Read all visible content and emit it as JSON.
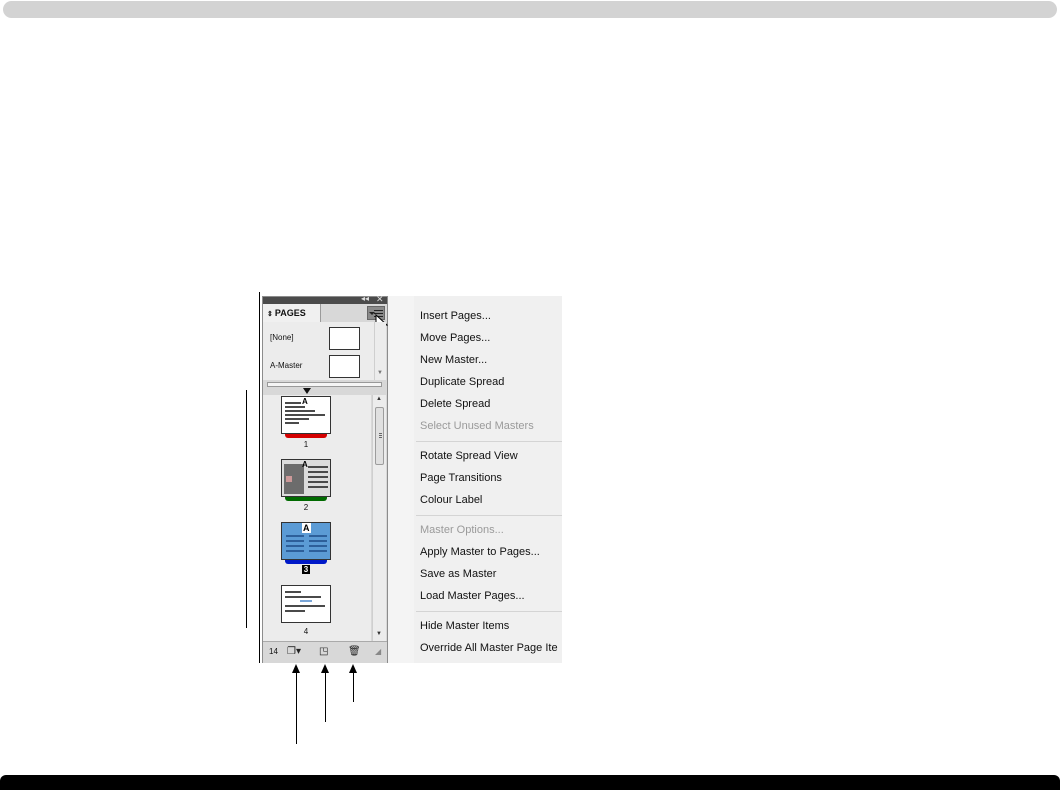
{
  "panel": {
    "tab_label": "PAGES",
    "masters": [
      {
        "label": "[None]"
      },
      {
        "label": "A-Master"
      }
    ],
    "pages": [
      {
        "number": "1",
        "master_letter": "A",
        "label_color": "#d40000"
      },
      {
        "number": "2",
        "master_letter": "A",
        "label_color": "#006a00"
      },
      {
        "number": "3",
        "master_letter": "A",
        "label_color": "#0019c8",
        "selected": true
      },
      {
        "number": "4",
        "master_letter": "",
        "label_color": ""
      }
    ],
    "page_count": "14",
    "footer_icons": [
      "new-page-size-icon",
      "create-new-page-icon",
      "delete-page-icon"
    ]
  },
  "menu": {
    "groups": [
      [
        {
          "label": "Insert Pages...",
          "enabled": true
        },
        {
          "label": "Move Pages...",
          "enabled": true
        },
        {
          "label": "New Master...",
          "enabled": true
        },
        {
          "label": "Duplicate Spread",
          "enabled": true
        },
        {
          "label": "Delete Spread",
          "enabled": true
        },
        {
          "label": "Select Unused Masters",
          "enabled": false
        }
      ],
      [
        {
          "label": "Rotate Spread View",
          "enabled": true
        },
        {
          "label": "Page Transitions",
          "enabled": true
        },
        {
          "label": "Colour Label",
          "enabled": true
        }
      ],
      [
        {
          "label": "Master Options...",
          "enabled": false
        },
        {
          "label": "Apply Master to Pages...",
          "enabled": true
        },
        {
          "label": "Save as Master",
          "enabled": true
        },
        {
          "label": "Load Master Pages...",
          "enabled": true
        }
      ],
      [
        {
          "label": "Hide Master Items",
          "enabled": true
        },
        {
          "label": "Override All Master Page Ite",
          "enabled": true
        }
      ]
    ]
  },
  "colors": {
    "panel_bg": "#d8d8d8",
    "menu_bg": "#f0f0f0",
    "selected_page_fill": "#5b9bd5"
  }
}
